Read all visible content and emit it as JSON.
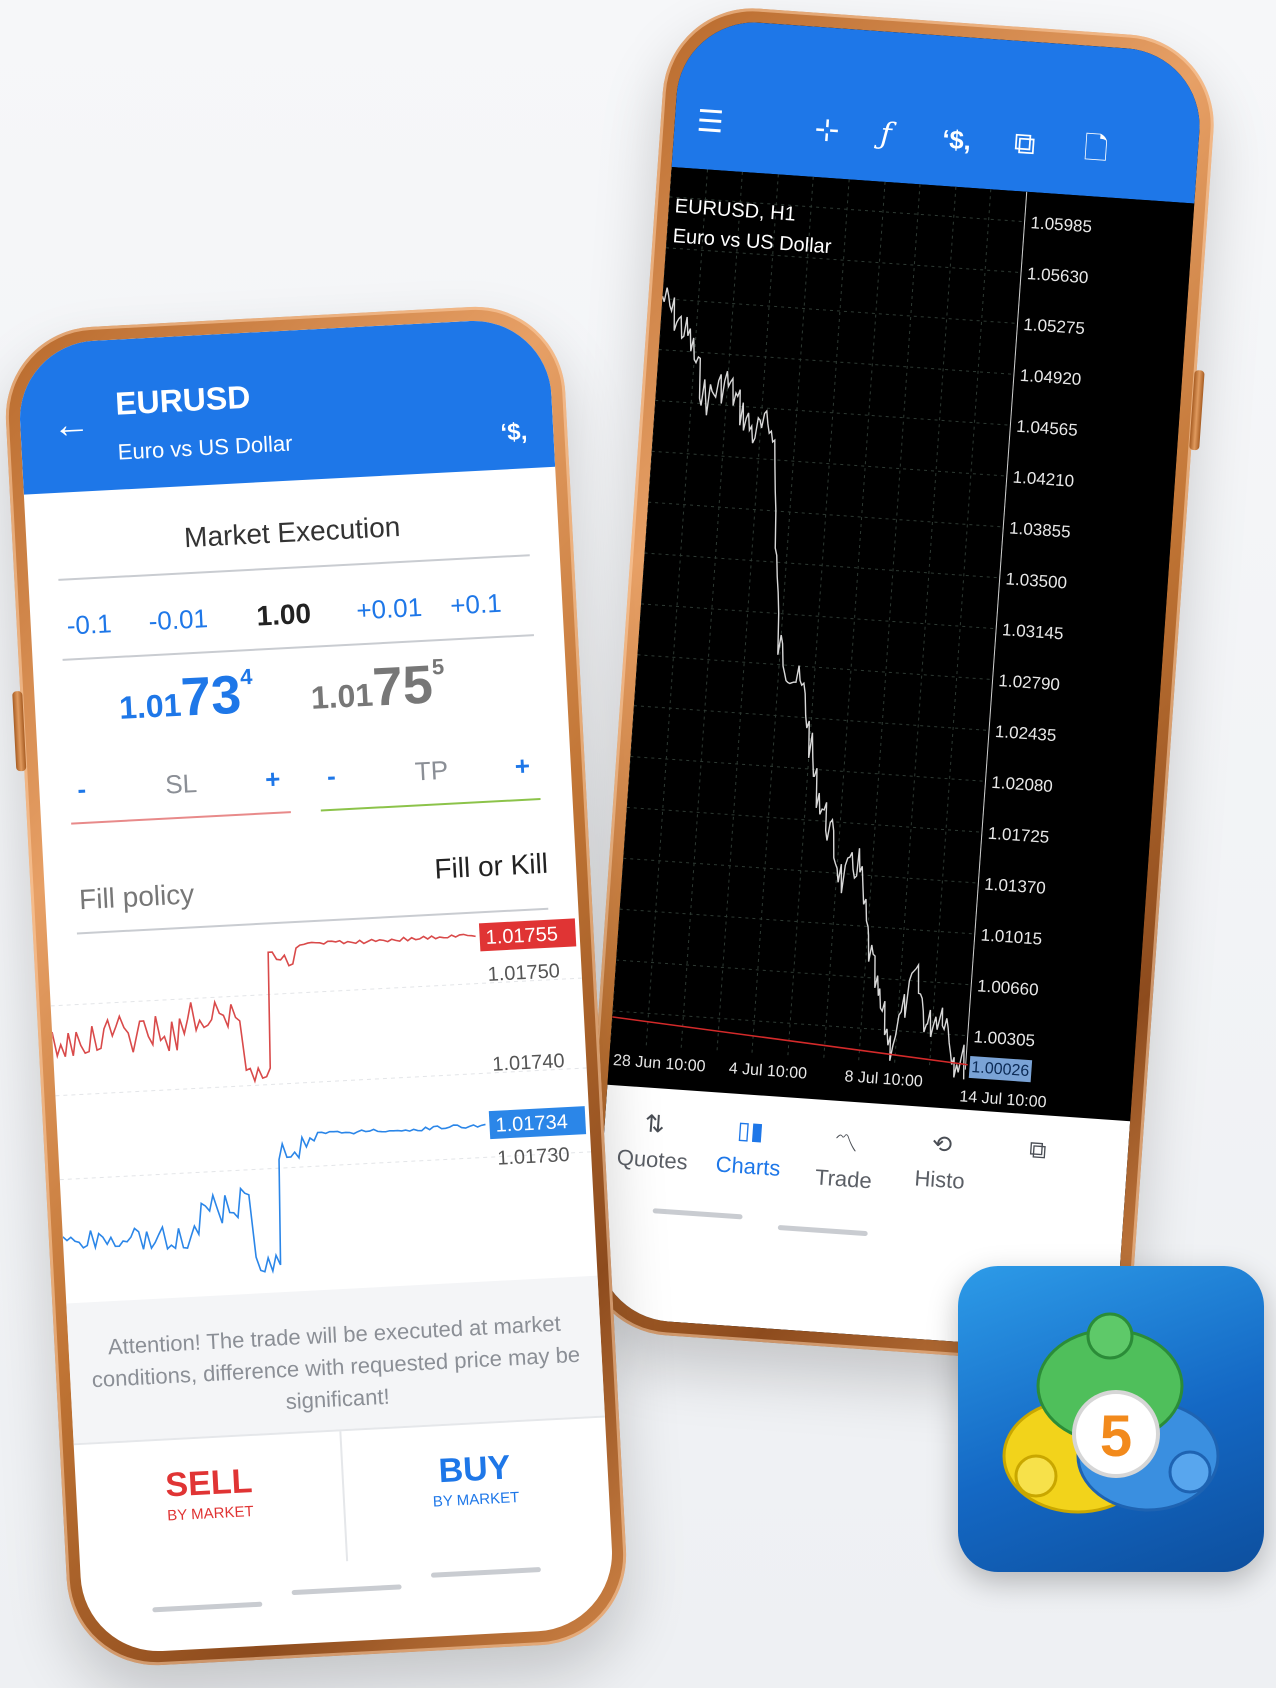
{
  "chart_screen": {
    "toolbar_icons": [
      "menu-icon",
      "crosshair-icon",
      "function-icon",
      "dollar-trade-icon",
      "windows-icon",
      "add-document-icon"
    ],
    "symbol_line": "EURUSD, H1",
    "description": "Euro vs US Dollar",
    "price_axis": [
      "1.05985",
      "1.05630",
      "1.05275",
      "1.04920",
      "1.04565",
      "1.04210",
      "1.03855",
      "1.03500",
      "1.03145",
      "1.02790",
      "1.02435",
      "1.02080",
      "1.01725",
      "1.01370",
      "1.01015",
      "1.00660",
      "1.00305"
    ],
    "current_price": "1.00026",
    "time_axis": [
      "28 Jun 10:00",
      "4 Jul 10:00",
      "8 Jul 10:00",
      "14 Jul 10:00"
    ],
    "nav": [
      {
        "label": "Quotes",
        "icon": "quotes-icon"
      },
      {
        "label": "Charts",
        "icon": "charts-icon"
      },
      {
        "label": "Trade",
        "icon": "trade-icon"
      },
      {
        "label": "Histo",
        "icon": "history-icon"
      },
      {
        "label": "",
        "icon": "messages-icon"
      }
    ]
  },
  "trade_screen": {
    "symbol": "EURUSD",
    "description": "Euro vs US Dollar",
    "execution": "Market Execution",
    "volume": {
      "minus_big": "-0.1",
      "minus_small": "-0.01",
      "value": "1.00",
      "plus_small": "+0.01",
      "plus_big": "+0.1"
    },
    "sell_price": {
      "prefix": "1.01",
      "big": "73",
      "sup": "4"
    },
    "buy_price": {
      "prefix": "1.01",
      "big": "75",
      "sup": "5"
    },
    "sl": {
      "label": "SL",
      "minus": "-",
      "plus": "+"
    },
    "tp": {
      "label": "TP",
      "minus": "-",
      "plus": "+"
    },
    "fill_policy": {
      "label": "Fill policy",
      "value": "Fill or Kill"
    },
    "tick_chart": {
      "ask_label": "1.01755",
      "level_1": "1.01750",
      "level_2": "1.01740",
      "bid_label": "1.01734",
      "level_3": "1.01730"
    },
    "attention": "Attention! The trade will be executed at market conditions, difference with requested price may be significant!",
    "sell_button": {
      "label": "SELL",
      "sub": "BY MARKET"
    },
    "buy_button": {
      "label": "BUY",
      "sub": "BY MARKET"
    }
  },
  "app_icon": {
    "badge": "5"
  },
  "colors": {
    "accent_blue": "#1e77e8",
    "sell_red": "#e03434",
    "tp_green": "#8cc34a",
    "copper": "#c07434"
  }
}
